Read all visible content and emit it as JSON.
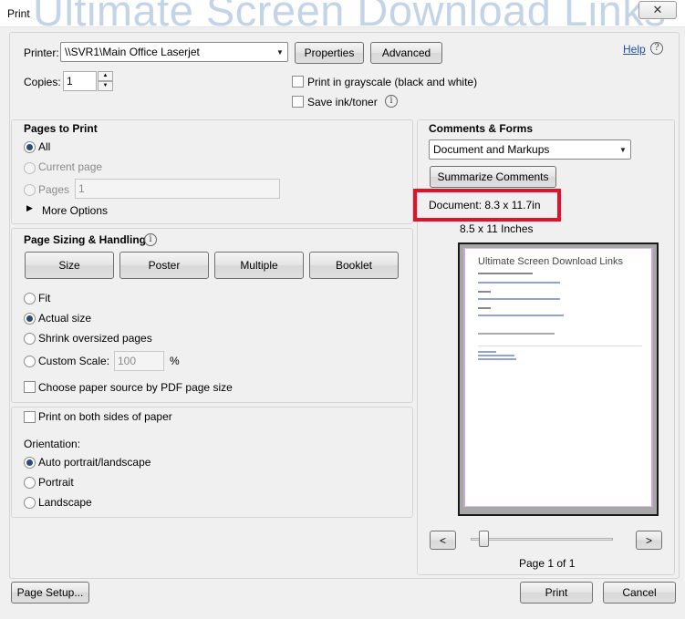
{
  "window": {
    "title": "Print",
    "watermark": "Ultimate Screen Download Links",
    "close_glyph": "✕"
  },
  "printer": {
    "label": "Printer:",
    "selected": "\\\\SVR1\\Main Office Laserjet",
    "properties_label": "Properties",
    "advanced_label": "Advanced",
    "help_label": "Help",
    "copies_label": "Copies:",
    "copies_value": "1",
    "grayscale_label": "Print in grayscale (black and white)",
    "save_ink_label": "Save ink/toner"
  },
  "pages_to_print": {
    "title": "Pages to Print",
    "all_label": "All",
    "current_label": "Current page",
    "pages_label": "Pages",
    "pages_value": "1",
    "more_options_label": "More Options"
  },
  "sizing": {
    "title": "Page Sizing & Handling",
    "tabs": [
      "Size",
      "Poster",
      "Multiple",
      "Booklet"
    ],
    "fit_label": "Fit",
    "actual_label": "Actual size",
    "shrink_label": "Shrink oversized pages",
    "custom_label": "Custom Scale:",
    "custom_value": "100",
    "percent": "%",
    "paper_source_label": "Choose paper source by PDF page size"
  },
  "duplex": {
    "both_sides_label": "Print on both sides of paper",
    "orientation_label": "Orientation:",
    "auto_label": "Auto portrait/landscape",
    "portrait_label": "Portrait",
    "landscape_label": "Landscape"
  },
  "comments_forms": {
    "title": "Comments & Forms",
    "selected": "Document and Markups",
    "summarize_label": "Summarize Comments"
  },
  "preview": {
    "document_size": "Document: 8.3 x 11.7in",
    "paper_size": "8.5 x 11 Inches",
    "page_heading": "Ultimate Screen Download Links",
    "prev_glyph": "<",
    "next_glyph": ">",
    "page_indicator": "Page 1 of 1",
    "slider_fraction": 0
  },
  "footer": {
    "page_setup_label": "Page Setup...",
    "print_label": "Print",
    "cancel_label": "Cancel"
  }
}
